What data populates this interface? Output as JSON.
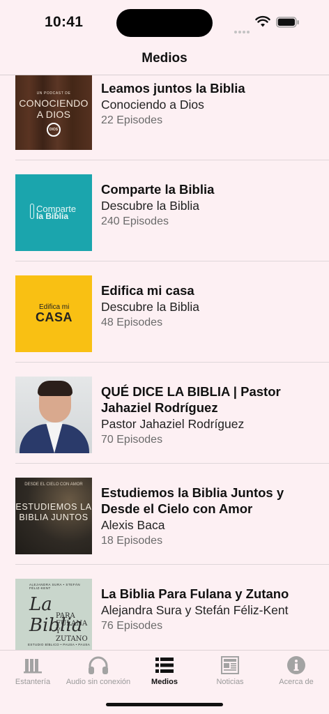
{
  "status": {
    "time": "10:41"
  },
  "nav": {
    "title": "Medios"
  },
  "podcasts": [
    {
      "title": "Leamos juntos la Biblia",
      "author": "Conociendo a Dios",
      "episodes": "22 Episodes",
      "art": {
        "top": "UN PODCAST DE",
        "main": "CONOCIENDO A DIOS",
        "badge": "DIOS"
      }
    },
    {
      "title": "Comparte la Biblia",
      "author": "Descubre la Biblia",
      "episodes": "240 Episodes",
      "art": {
        "line1": "Comparte",
        "line2": "la Biblia"
      }
    },
    {
      "title": "Edifica mi casa",
      "author": "Descubre la Biblia",
      "episodes": "48 Episodes",
      "art": {
        "line1": "Edifica mi",
        "line2": "CASA"
      }
    },
    {
      "title": "QUÉ DICE LA BIBLIA | Pastor Jahaziel Rodríguez",
      "author": "Pastor Jahaziel Rodríguez",
      "episodes": "70 Episodes",
      "art": {}
    },
    {
      "title": "Estudiemos la Biblia Juntos y Desde el Cielo con Amor",
      "author": "Alexis Baca",
      "episodes": "18 Episodes",
      "art": {
        "top": "DESDE EL CIELO CON AMOR",
        "main": "ESTUDIEMOS LA BIBLIA JUNTOS"
      }
    },
    {
      "title": "La Biblia Para Fulana y Zutano",
      "author": "Alejandra Sura y Stefán Féliz-Kent",
      "episodes": "76 Episodes",
      "art": {
        "top": "ALEJANDRA SURA • STEFÁN FÉLIZ-KENT",
        "main": "La Biblia",
        "sub": "PARA FULANA Y ZUTANO",
        "footer": "ESTUDIO BÍBLICO • PAUSA • PAUSA"
      }
    }
  ],
  "tabs": [
    {
      "label": "Estantería",
      "icon": "bookshelf-icon",
      "active": false
    },
    {
      "label": "Audio sin conexión",
      "icon": "headphones-icon",
      "active": false
    },
    {
      "label": "Medios",
      "icon": "list-icon",
      "active": true
    },
    {
      "label": "Noticias",
      "icon": "newspaper-icon",
      "active": false
    },
    {
      "label": "Acerca de",
      "icon": "info-icon",
      "active": false
    }
  ],
  "colors": {
    "background": "#fdf0f3",
    "active_tab": "#111111",
    "inactive_tab": "#9a9a9a"
  }
}
